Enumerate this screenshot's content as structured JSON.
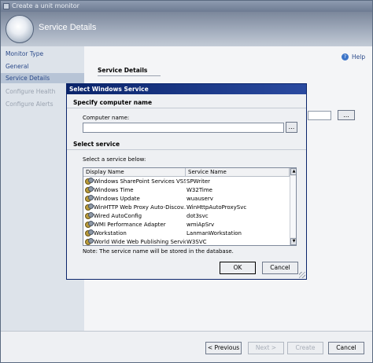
{
  "window": {
    "title": "Create a unit monitor"
  },
  "banner": {
    "title": "Service Details"
  },
  "nav": {
    "items": [
      {
        "label": "Monitor Type",
        "state": "normal"
      },
      {
        "label": "General",
        "state": "normal"
      },
      {
        "label": "Service Details",
        "state": "selected"
      },
      {
        "label": "Configure Health",
        "state": "disabled"
      },
      {
        "label": "Configure Alerts",
        "state": "disabled"
      }
    ]
  },
  "help": {
    "label": "Help",
    "icon": "help-icon"
  },
  "content": {
    "section_title": "Service Details",
    "browse_label": "..."
  },
  "wizard_buttons": {
    "previous": "< Previous",
    "next": "Next >",
    "create": "Create",
    "cancel": "Cancel"
  },
  "dialog": {
    "title": "Select Windows Service",
    "computer_section": "Specify computer name",
    "computer_label": "Computer name:",
    "computer_value": "",
    "browse_label": "...",
    "service_section": "Select service",
    "service_label": "Select a service below:",
    "columns": {
      "display": "Display Name",
      "service": "Service Name"
    },
    "rows": [
      {
        "display": "Windows SharePoint Services VSS...",
        "service": "SPWriter"
      },
      {
        "display": "Windows Time",
        "service": "W32Time"
      },
      {
        "display": "Windows Update",
        "service": "wuauserv"
      },
      {
        "display": "WinHTTP Web Proxy Auto-Discov...",
        "service": "WinHttpAutoProxySvc"
      },
      {
        "display": "Wired AutoConfig",
        "service": "dot3svc"
      },
      {
        "display": "WMI Performance Adapter",
        "service": "wmiApSrv"
      },
      {
        "display": "Workstation",
        "service": "LanmanWorkstation"
      },
      {
        "display": "World Wide Web Publishing Service",
        "service": "W3SVC"
      }
    ],
    "note": "Note: The service name will be stored in the database.",
    "ok_label": "OK",
    "cancel_label": "Cancel"
  }
}
